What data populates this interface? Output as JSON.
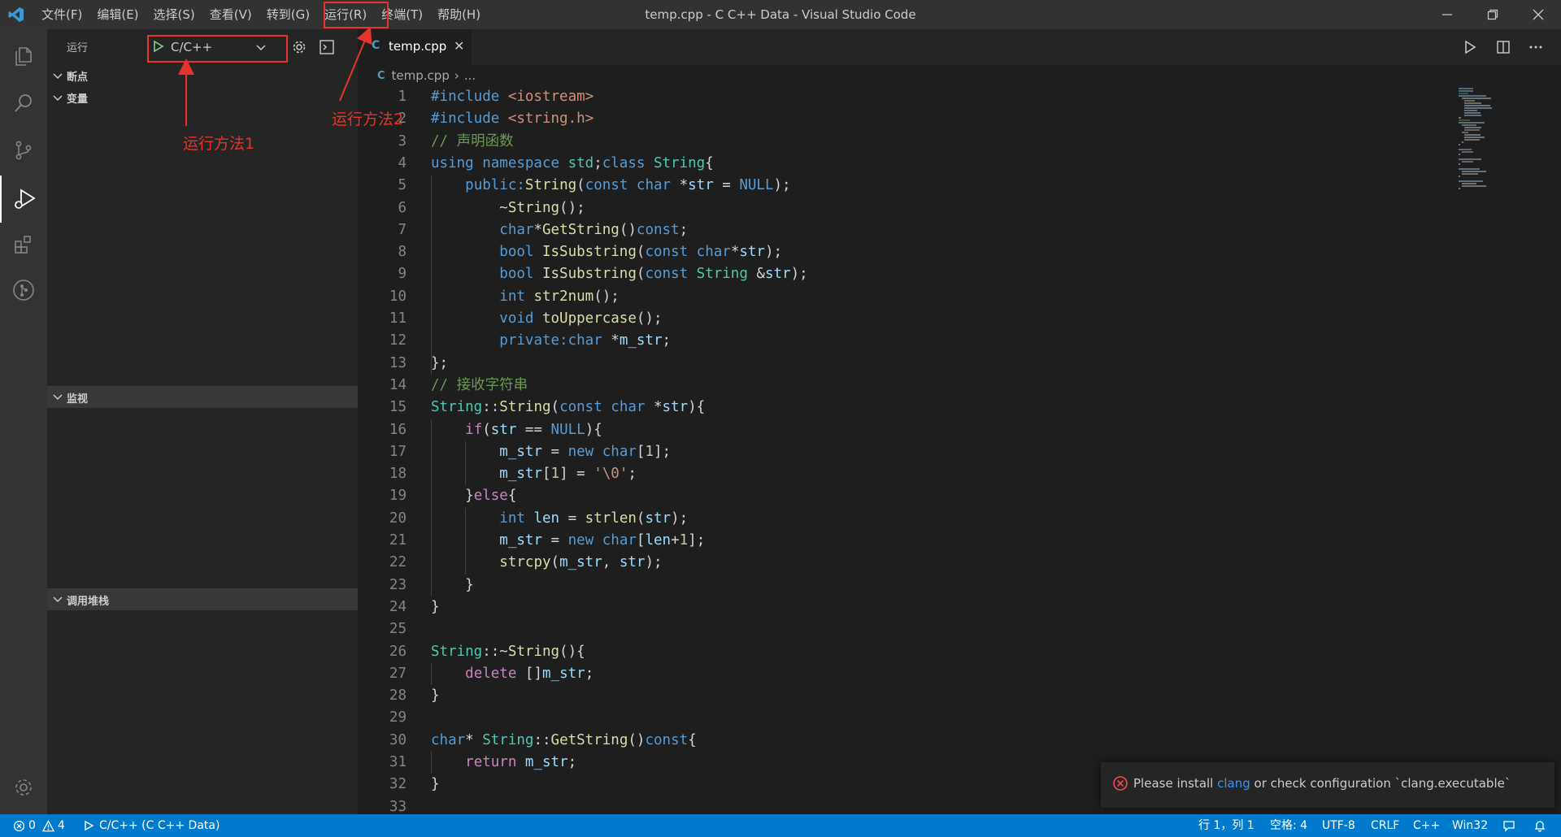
{
  "window": {
    "title": "temp.cpp - C C++ Data - Visual Studio Code",
    "menu": [
      "文件(F)",
      "编辑(E)",
      "选择(S)",
      "查看(V)",
      "转到(G)",
      "运行(R)",
      "终端(T)",
      "帮助(H)"
    ]
  },
  "sidebar": {
    "title": "运行",
    "config": "C/C++",
    "sections": {
      "breakpoints": "断点",
      "variables": "变量",
      "watch": "监视",
      "callstack": "调用堆栈"
    }
  },
  "annotations": {
    "method1": "运行方法1",
    "method2": "运行方法2",
    "color": "#e5342c"
  },
  "editor": {
    "tab": "temp.cpp",
    "breadcrumb_file": "temp.cpp",
    "breadcrumb_more": "...",
    "line_numbers": [
      "1",
      "2",
      "3",
      "4",
      "5",
      "6",
      "7",
      "8",
      "9",
      "10",
      "11",
      "12",
      "13",
      "14",
      "15",
      "16",
      "17",
      "18",
      "19",
      "20",
      "21",
      "22",
      "23",
      "24",
      "25",
      "26",
      "27",
      "28",
      "29",
      "30",
      "31",
      "32",
      "33"
    ],
    "lines": [
      [
        [
          "k",
          "#include "
        ],
        [
          "s",
          "<iostream>"
        ]
      ],
      [
        [
          "k",
          "#include "
        ],
        [
          "s",
          "<string.h>"
        ]
      ],
      [
        [
          "cm",
          "// 声明函数"
        ]
      ],
      [
        [
          "k",
          "using "
        ],
        [
          "k",
          "namespace "
        ],
        [
          "t",
          "std"
        ],
        [
          "p",
          ";"
        ],
        [
          "k",
          "class "
        ],
        [
          "t",
          "String"
        ],
        [
          "p",
          "{"
        ]
      ],
      [
        [
          "p",
          "    "
        ],
        [
          "k",
          "public:"
        ],
        [
          "f",
          "String"
        ],
        [
          "p",
          "("
        ],
        [
          "k",
          "const "
        ],
        [
          "k",
          "char "
        ],
        [
          "p",
          "*"
        ],
        [
          "v",
          "str"
        ],
        [
          "p",
          " = "
        ],
        [
          "k",
          "NULL"
        ],
        [
          "p",
          ");"
        ]
      ],
      [
        [
          "p",
          "        ~"
        ],
        [
          "f",
          "String"
        ],
        [
          "p",
          "();"
        ]
      ],
      [
        [
          "p",
          "        "
        ],
        [
          "k",
          "char"
        ],
        [
          "p",
          "*"
        ],
        [
          "f",
          "GetString"
        ],
        [
          "p",
          "()"
        ],
        [
          "k",
          "const"
        ],
        [
          "p",
          ";"
        ]
      ],
      [
        [
          "p",
          "        "
        ],
        [
          "k",
          "bool "
        ],
        [
          "f",
          "IsSubstring"
        ],
        [
          "p",
          "("
        ],
        [
          "k",
          "const "
        ],
        [
          "k",
          "char"
        ],
        [
          "p",
          "*"
        ],
        [
          "v",
          "str"
        ],
        [
          "p",
          ");"
        ]
      ],
      [
        [
          "p",
          "        "
        ],
        [
          "k",
          "bool "
        ],
        [
          "f",
          "IsSubstring"
        ],
        [
          "p",
          "("
        ],
        [
          "k",
          "const "
        ],
        [
          "t",
          "String "
        ],
        [
          "p",
          "&"
        ],
        [
          "v",
          "str"
        ],
        [
          "p",
          ");"
        ]
      ],
      [
        [
          "p",
          "        "
        ],
        [
          "k",
          "int "
        ],
        [
          "f",
          "str2num"
        ],
        [
          "p",
          "();"
        ]
      ],
      [
        [
          "p",
          "        "
        ],
        [
          "k",
          "void "
        ],
        [
          "f",
          "toUppercase"
        ],
        [
          "p",
          "();"
        ]
      ],
      [
        [
          "p",
          "        "
        ],
        [
          "k",
          "private:"
        ],
        [
          "k",
          "char "
        ],
        [
          "p",
          "*"
        ],
        [
          "v",
          "m_str"
        ],
        [
          "p",
          ";"
        ]
      ],
      [
        [
          "p",
          "};"
        ]
      ],
      [
        [
          "cm",
          "// 接收字符串"
        ]
      ],
      [
        [
          "t",
          "String"
        ],
        [
          "p",
          "::"
        ],
        [
          "f",
          "String"
        ],
        [
          "p",
          "("
        ],
        [
          "k",
          "const "
        ],
        [
          "k",
          "char "
        ],
        [
          "p",
          "*"
        ],
        [
          "v",
          "str"
        ],
        [
          "p",
          "){"
        ]
      ],
      [
        [
          "p",
          "    "
        ],
        [
          "c",
          "if"
        ],
        [
          "p",
          "("
        ],
        [
          "v",
          "str"
        ],
        [
          "p",
          " == "
        ],
        [
          "k",
          "NULL"
        ],
        [
          "p",
          "){"
        ]
      ],
      [
        [
          "p",
          "        "
        ],
        [
          "v",
          "m_str"
        ],
        [
          "p",
          " = "
        ],
        [
          "k",
          "new "
        ],
        [
          "k",
          "char"
        ],
        [
          "p",
          "["
        ],
        [
          "n",
          "1"
        ],
        [
          "p",
          "];"
        ]
      ],
      [
        [
          "p",
          "        "
        ],
        [
          "v",
          "m_str"
        ],
        [
          "p",
          "["
        ],
        [
          "n",
          "1"
        ],
        [
          "p",
          "] = "
        ],
        [
          "s",
          "'\\0'"
        ],
        [
          "p",
          ";"
        ]
      ],
      [
        [
          "p",
          "    }"
        ],
        [
          "c",
          "else"
        ],
        [
          "p",
          "{"
        ]
      ],
      [
        [
          "p",
          "        "
        ],
        [
          "k",
          "int "
        ],
        [
          "v",
          "len"
        ],
        [
          "p",
          " = "
        ],
        [
          "f",
          "strlen"
        ],
        [
          "p",
          "("
        ],
        [
          "v",
          "str"
        ],
        [
          "p",
          ");"
        ]
      ],
      [
        [
          "p",
          "        "
        ],
        [
          "v",
          "m_str"
        ],
        [
          "p",
          " = "
        ],
        [
          "k",
          "new "
        ],
        [
          "k",
          "char"
        ],
        [
          "p",
          "["
        ],
        [
          "v",
          "len"
        ],
        [
          "p",
          "+"
        ],
        [
          "n",
          "1"
        ],
        [
          "p",
          "];"
        ]
      ],
      [
        [
          "p",
          "        "
        ],
        [
          "f",
          "strcpy"
        ],
        [
          "p",
          "("
        ],
        [
          "v",
          "m_str"
        ],
        [
          "p",
          ", "
        ],
        [
          "v",
          "str"
        ],
        [
          "p",
          ");"
        ]
      ],
      [
        [
          "p",
          "    }"
        ]
      ],
      [
        [
          "p",
          "}"
        ]
      ],
      [],
      [
        [
          "t",
          "String"
        ],
        [
          "p",
          "::~"
        ],
        [
          "f",
          "String"
        ],
        [
          "p",
          "(){"
        ]
      ],
      [
        [
          "p",
          "    "
        ],
        [
          "c",
          "delete "
        ],
        [
          "p",
          "[]"
        ],
        [
          "v",
          "m_str"
        ],
        [
          "p",
          ";"
        ]
      ],
      [
        [
          "p",
          "}"
        ]
      ],
      [],
      [
        [
          "k",
          "char"
        ],
        [
          "p",
          "* "
        ],
        [
          "t",
          "String"
        ],
        [
          "p",
          "::"
        ],
        [
          "f",
          "GetString"
        ],
        [
          "p",
          "()"
        ],
        [
          "k",
          "const"
        ],
        [
          "p",
          "{"
        ]
      ],
      [
        [
          "p",
          "    "
        ],
        [
          "c",
          "return "
        ],
        [
          "v",
          "m_str"
        ],
        [
          "p",
          ";"
        ]
      ],
      [
        [
          "p",
          "}"
        ]
      ],
      []
    ]
  },
  "notification": {
    "prefix": "Please install ",
    "link": "clang",
    "suffix": " or check configuration `clang.executable`"
  },
  "statusbar": {
    "errors": "0",
    "warnings": "4",
    "debug": "C/C++ (C C++ Data)",
    "position": "行 1，列 1",
    "spaces": "空格: 4",
    "encoding": "UTF-8",
    "eol": "CRLF",
    "language": "C++",
    "platform": "Win32"
  }
}
